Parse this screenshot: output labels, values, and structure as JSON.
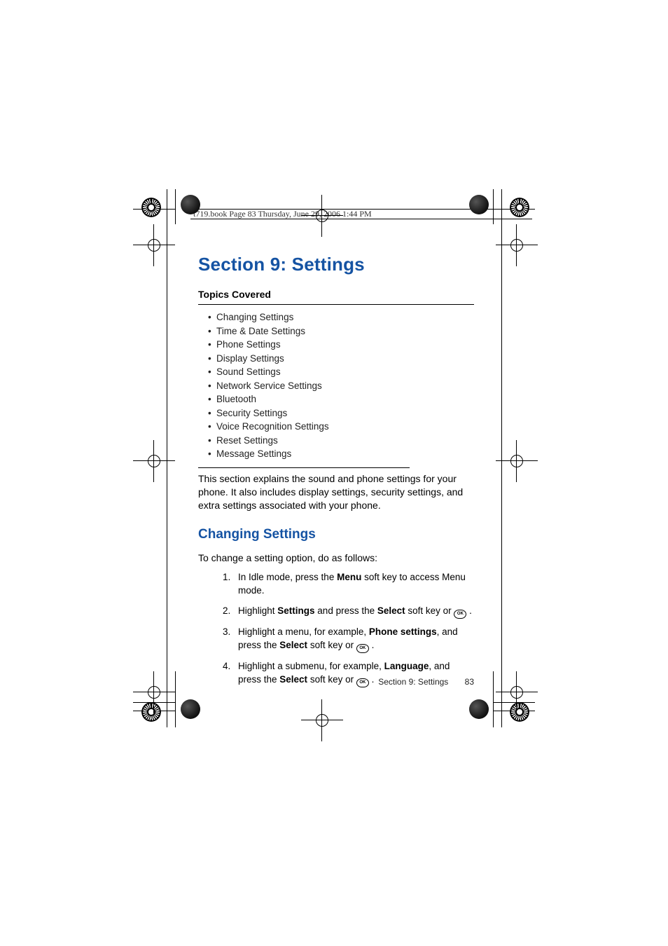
{
  "header": {
    "running_head": "t719.book  Page 83  Thursday, June 29, 2006  1:44 PM"
  },
  "section": {
    "title": "Section 9: Settings"
  },
  "topics": {
    "heading": "Topics Covered",
    "items": [
      "Changing Settings",
      "Time & Date Settings",
      "Phone Settings",
      "Display Settings",
      "Sound Settings",
      "Network Service Settings",
      "Bluetooth",
      "Security Settings",
      "Voice Recognition Settings",
      "Reset Settings",
      "Message Settings"
    ]
  },
  "intro": "This section explains the sound and phone settings for your phone. It also includes display settings, security settings, and extra settings associated with your phone.",
  "subheading": "Changing Settings",
  "change_intro": "To change a setting option, do as follows:",
  "steps": {
    "s1_pre": "In Idle mode, press the ",
    "s1_bold": "Menu",
    "s1_post": " soft key to access Menu mode.",
    "s2_pre": "Highlight ",
    "s2_b1": "Settings",
    "s2_mid": " and press the ",
    "s2_b2": "Select",
    "s2_post": " soft key or ",
    "s3_pre": "Highlight a menu, for example, ",
    "s3_b1": "Phone settings",
    "s3_mid": ", and press the ",
    "s3_b2": "Select",
    "s3_post": " soft key or ",
    "s4_pre": "Highlight a submenu, for example, ",
    "s4_b1": "Language",
    "s4_mid": ", and press the ",
    "s4_b2": "Select",
    "s4_post": " soft key or ",
    "ok_label": "OK",
    "period": " ."
  },
  "footer": {
    "section_label": "Section 9: Settings",
    "page_number": "83"
  }
}
